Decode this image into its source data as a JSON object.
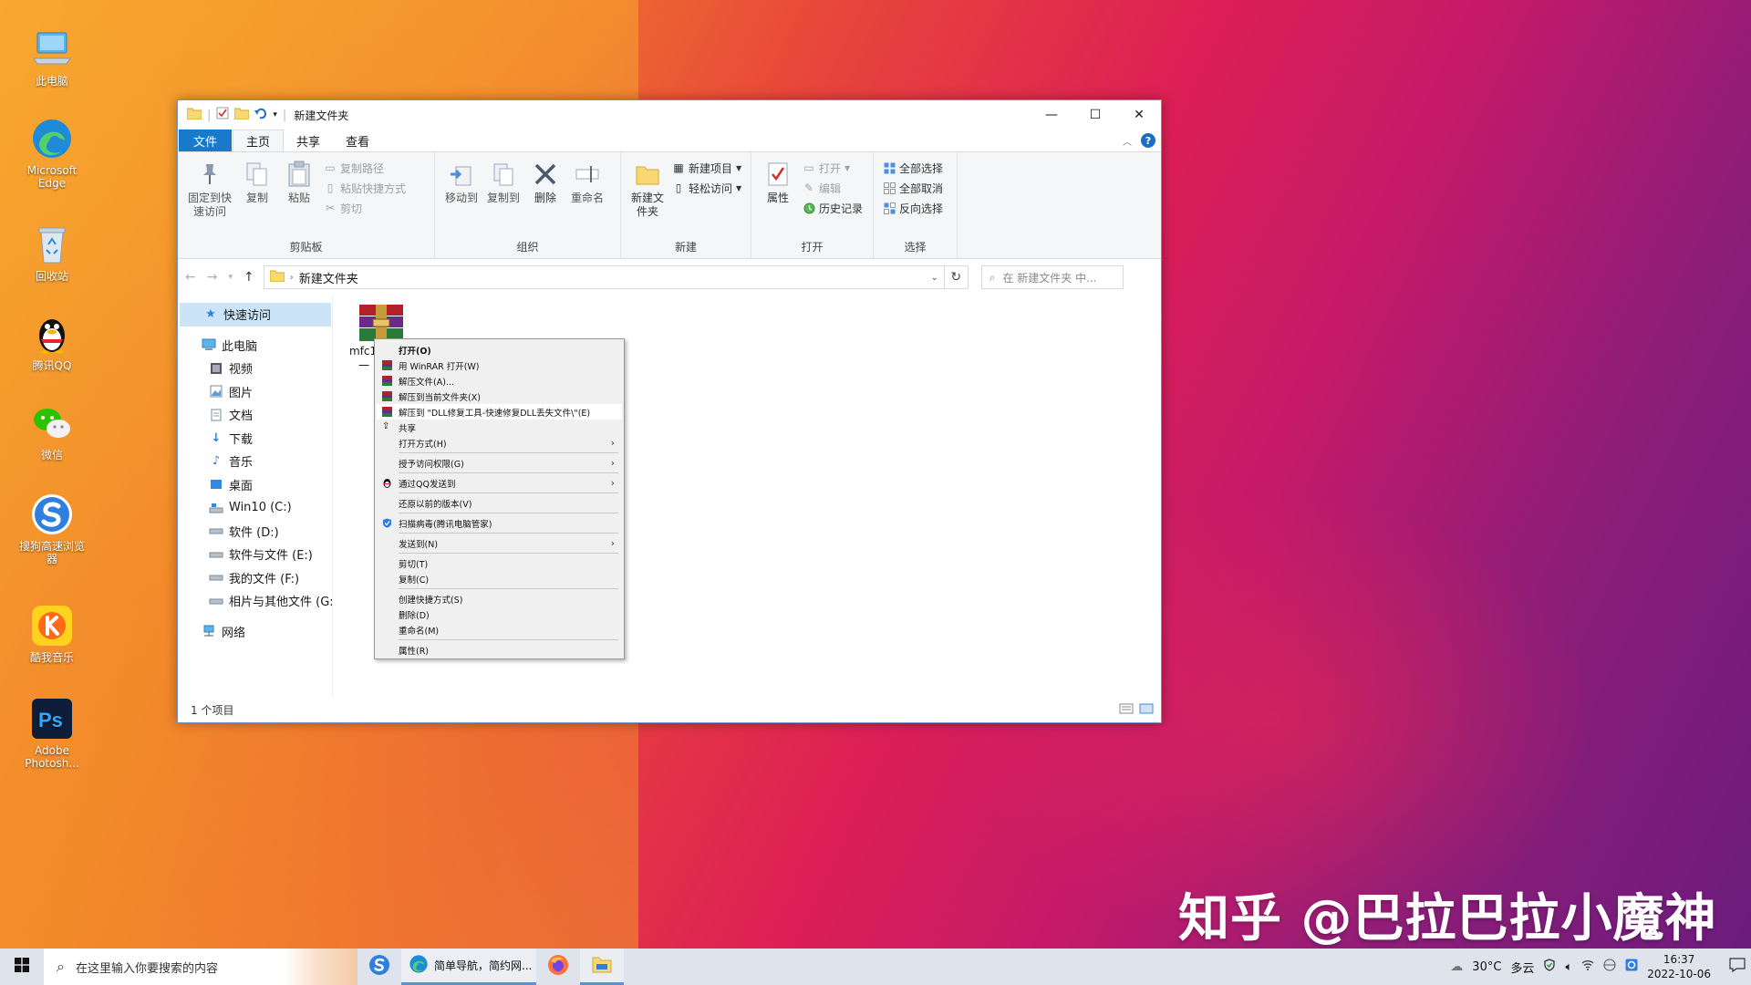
{
  "desktop": {
    "icons": [
      {
        "label": "此电脑"
      },
      {
        "label": "Microsoft Edge"
      },
      {
        "label": "回收站"
      },
      {
        "label": "腾讯QQ"
      },
      {
        "label": "微信"
      },
      {
        "label": "搜狗高速浏览器"
      },
      {
        "label": "酷我音乐"
      },
      {
        "label": "Adobe Photosh..."
      }
    ],
    "watermark": "知乎 @巴拉巴拉小魔神"
  },
  "window": {
    "title": "新建文件夹",
    "tabs": [
      "文件",
      "主页",
      "共享",
      "查看"
    ],
    "ribbon": {
      "clipboard": {
        "pin": "固定到快速访问",
        "copy": "复制",
        "paste": "粘贴",
        "copy_path": "复制路径",
        "paste_shortcut": "粘贴快捷方式",
        "cut": "剪切",
        "label": "剪贴板"
      },
      "organize": {
        "move_to": "移动到",
        "copy_to": "复制到",
        "delete": "删除",
        "rename": "重命名",
        "label": "组织"
      },
      "new": {
        "new_folder": "新建文件夹",
        "new_item": "新建项目",
        "easy_access": "轻松访问",
        "label": "新建"
      },
      "open": {
        "properties": "属性",
        "open": "打开",
        "edit": "编辑",
        "history": "历史记录",
        "label": "打开"
      },
      "select": {
        "select_all": "全部选择",
        "select_none": "全部取消",
        "invert": "反向选择",
        "label": "选择"
      }
    },
    "address": {
      "path": "新建文件夹"
    },
    "search": {
      "placeholder": "在 新建文件夹 中..."
    },
    "nav": [
      {
        "label": "快速访问"
      },
      {
        "label": "此电脑"
      },
      {
        "label": "视频"
      },
      {
        "label": "图片"
      },
      {
        "label": "文档"
      },
      {
        "label": "下载"
      },
      {
        "label": "音乐"
      },
      {
        "label": "桌面"
      },
      {
        "label": "Win10 (C:)"
      },
      {
        "label": "软件 (D:)"
      },
      {
        "label": "软件与文件 (E:)"
      },
      {
        "label": "我的文件 (F:)"
      },
      {
        "label": "相片与其他文件 (G:"
      },
      {
        "label": "网络"
      }
    ],
    "file": {
      "name_line1": "mfc1",
      "name_line2": "一"
    },
    "status": "1 个项目"
  },
  "context_menu": {
    "items": [
      {
        "label": "打开(O)"
      },
      {
        "label": "用 WinRAR 打开(W)"
      },
      {
        "label": "解压文件(A)..."
      },
      {
        "label": "解压到当前文件夹(X)"
      },
      {
        "label": "解压到 \"DLL修复工具-快速修复DLL丢失文件\\\"(E)"
      },
      {
        "label": "共享"
      },
      {
        "label": "打开方式(H)"
      },
      {
        "label": "授予访问权限(G)"
      },
      {
        "label": "通过QQ发送到"
      },
      {
        "label": "还原以前的版本(V)"
      },
      {
        "label": "扫描病毒(腾讯电脑管家)"
      },
      {
        "label": "发送到(N)"
      },
      {
        "label": "剪切(T)"
      },
      {
        "label": "复制(C)"
      },
      {
        "label": "创建快捷方式(S)"
      },
      {
        "label": "删除(D)"
      },
      {
        "label": "重命名(M)"
      },
      {
        "label": "属性(R)"
      }
    ]
  },
  "taskbar": {
    "search_placeholder": "在这里输入你要搜索的内容",
    "edge_label": "简单导航，简约网...",
    "weather": "30°C",
    "weather_desc": "多云",
    "time": "16:37",
    "date": "2022-10-06"
  },
  "colors": {
    "accent": "#1979ca",
    "selection": "#cce4f7"
  }
}
